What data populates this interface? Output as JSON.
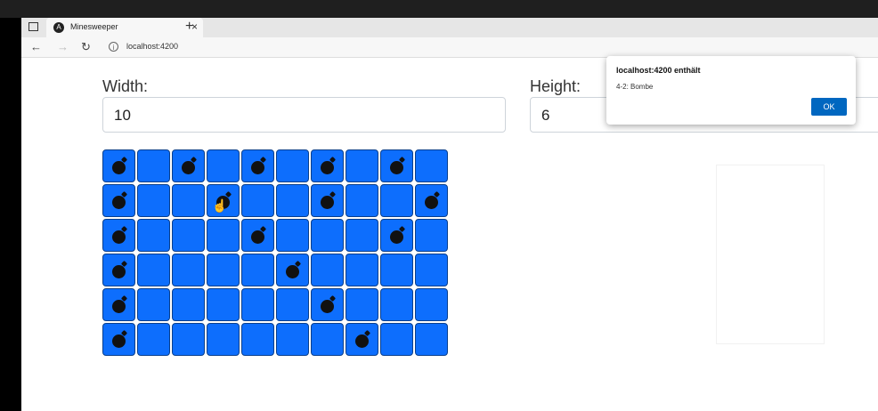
{
  "tab": {
    "title": "Minesweeper",
    "favicon": "angular-icon"
  },
  "url": "localhost:4200",
  "form": {
    "width_label": "Width:",
    "width_value": "10",
    "height_label": "Height:",
    "height_value": "6"
  },
  "board": {
    "columns": 10,
    "rows": 6,
    "bombs": [
      [
        1,
        0,
        1,
        0,
        1,
        0,
        1,
        0,
        1,
        0
      ],
      [
        1,
        0,
        0,
        1,
        0,
        0,
        1,
        0,
        0,
        1
      ],
      [
        1,
        0,
        0,
        0,
        1,
        0,
        0,
        0,
        1,
        0
      ],
      [
        1,
        0,
        0,
        0,
        0,
        1,
        0,
        0,
        0,
        0
      ],
      [
        1,
        0,
        0,
        0,
        0,
        0,
        1,
        0,
        0,
        0
      ],
      [
        1,
        0,
        0,
        0,
        0,
        0,
        0,
        1,
        0,
        0
      ]
    ],
    "cell_color": "#0d6efd"
  },
  "dialog": {
    "title": "localhost:4200 enthält",
    "message": "4-2: Bombe",
    "ok_label": "OK"
  }
}
